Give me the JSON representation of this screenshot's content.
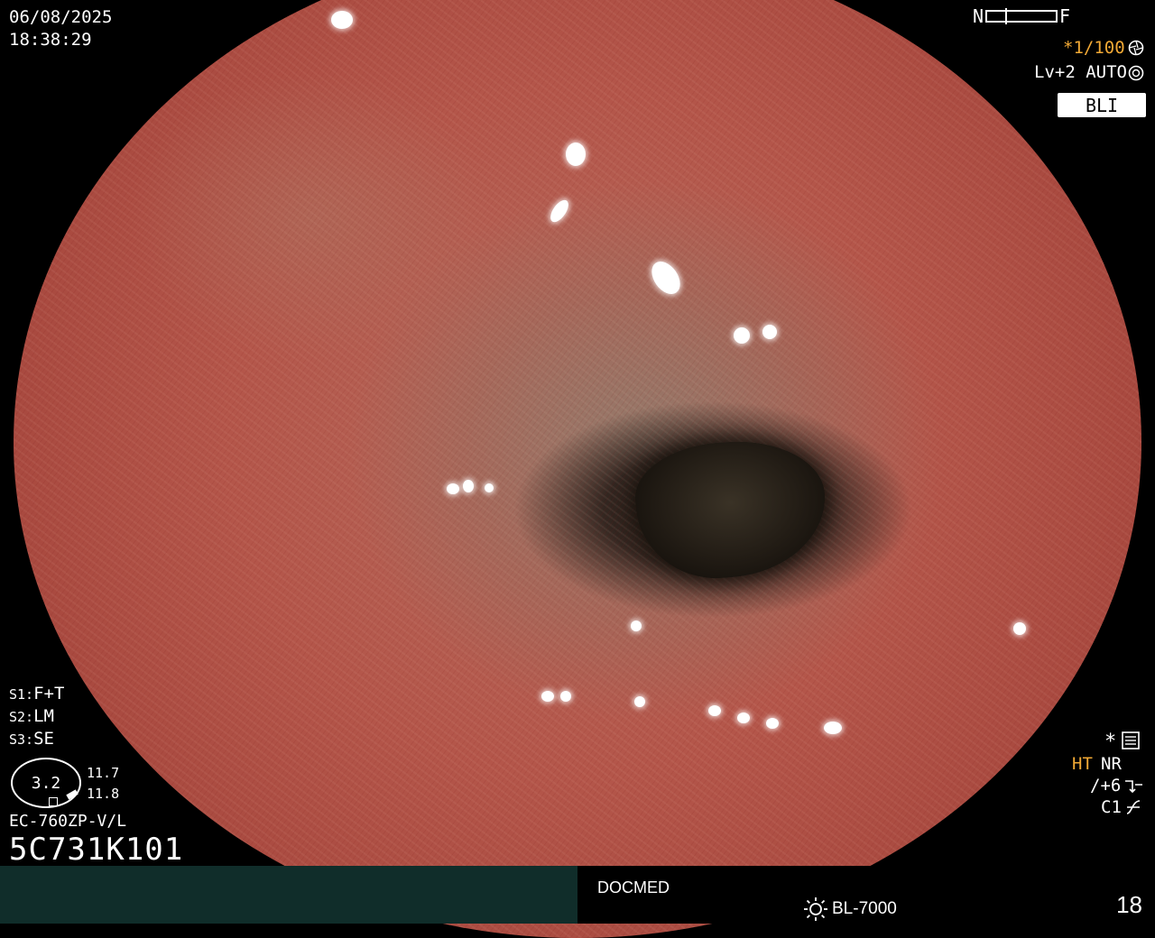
{
  "header": {
    "date": "06/08/2025",
    "time": "18:38:29"
  },
  "focus": {
    "near_label": "N",
    "far_label": "F"
  },
  "exposure": {
    "shutter_prefix": "*",
    "shutter": "1/100",
    "level": "Lv+2",
    "mode": "AUTO"
  },
  "mode_badge": "BLI",
  "settings": {
    "s1_key": "S1:",
    "s1_val": "F+T",
    "s2_key": "S2:",
    "s2_val": "LM",
    "s3_key": "S3:",
    "s3_val": "SE"
  },
  "gauge": {
    "value": "3.2",
    "top": "11.7",
    "bottom": "11.8"
  },
  "scope_model": "EC-760ZP-V/L",
  "scope_serial": "5C731K101",
  "right_panel": {
    "star": "*",
    "ht": "HT",
    "nr": "NR",
    "enhance": "/+6",
    "c1": "C1"
  },
  "bottom": {
    "institution": "DOCMED",
    "light_source": "BL-7000",
    "page": "18"
  },
  "colors": {
    "accent_orange": "#f2a935",
    "bottom_bar": "#102d2a"
  },
  "icons": [
    "iris-icon",
    "aperture-icon",
    "menu-settings-icon",
    "enhance-arrow-icon",
    "curve-icon",
    "sun-icon"
  ]
}
